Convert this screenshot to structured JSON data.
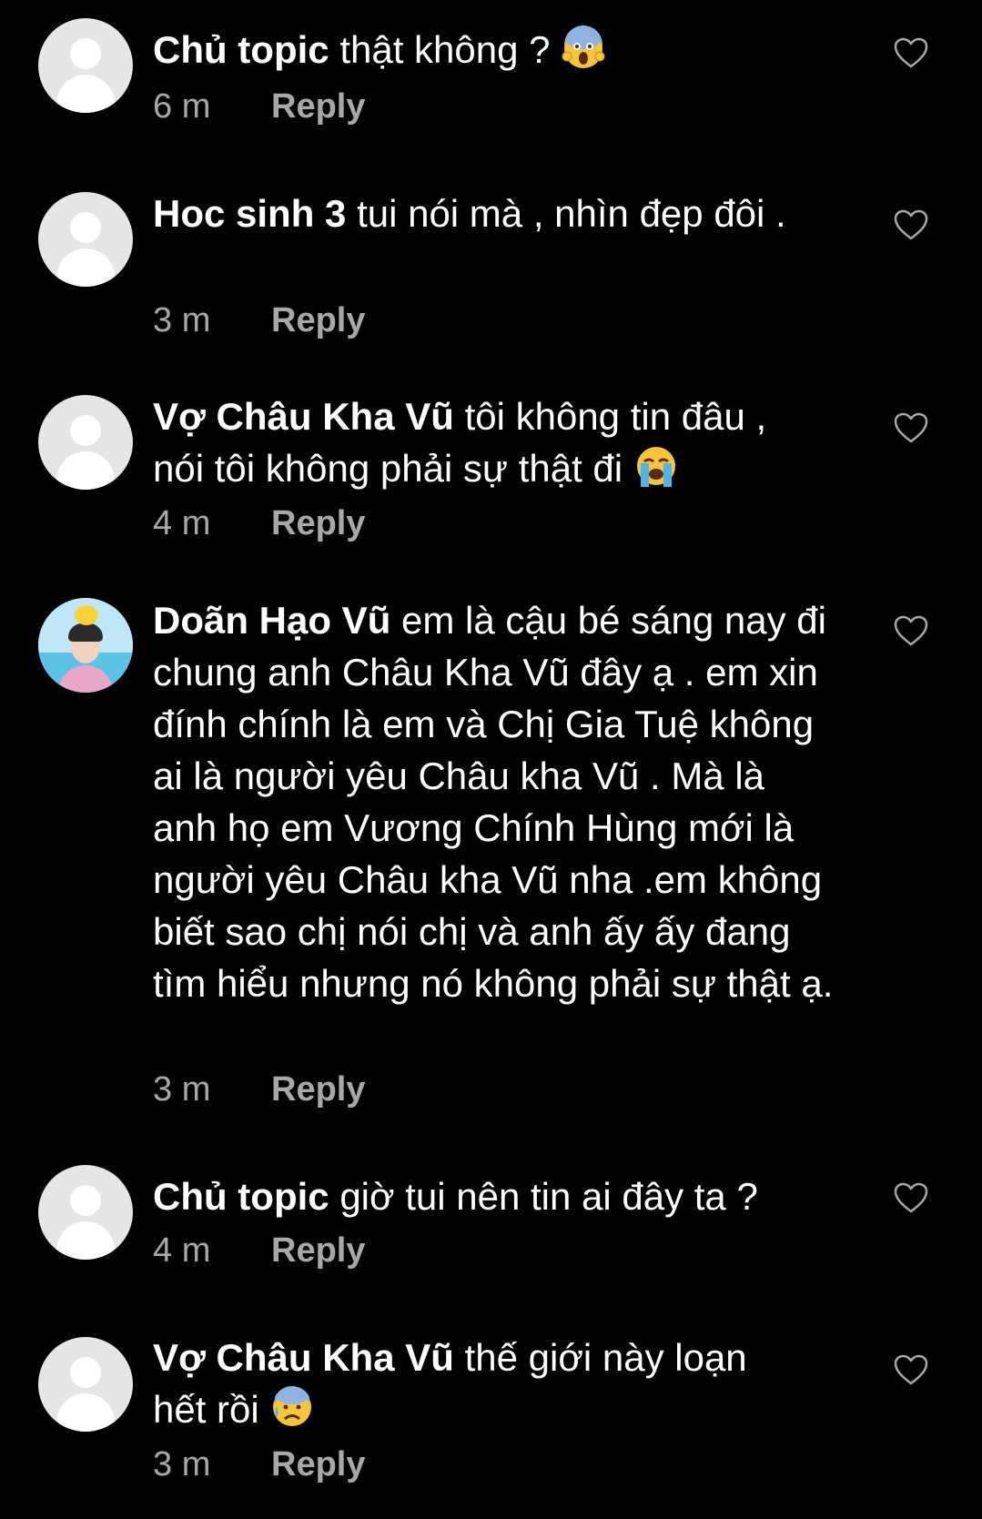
{
  "comments": [
    {
      "author": "Chủ topic",
      "text": "thật không ?",
      "emoji": "face-screaming-in-fear-icon",
      "time": "6 m",
      "reply": "Reply"
    },
    {
      "author": "Hoc sinh 3",
      "text": "tui nói mà , nhìn đẹp đôi .",
      "time": "3 m",
      "reply": "Reply"
    },
    {
      "author": "Vợ Châu Kha Vũ",
      "text": "tôi không tin đâu , nói tôi không phải sự thật đi",
      "emoji": "loudly-crying-face-icon",
      "time": "4 m",
      "reply": "Reply"
    },
    {
      "author": "Doãn Hạo Vũ",
      "text": "em là cậu bé sáng nay đi chung anh Châu Kha Vũ đây ạ . em xin đính chính là em và Chị Gia Tuệ không ai là người yêu Châu kha Vũ . Mà là anh họ em Vương Chính Hùng mới là người yêu Châu kha Vũ nha .em không biết sao chị nói chị và anh ấy ấy đang tìm hiểu nhưng nó không phải sự thật ạ.",
      "time": "3 m",
      "reply": "Reply"
    },
    {
      "author": "Chủ topic",
      "text": "giờ tui nên tin ai đây ta ?",
      "time": "4 m",
      "reply": "Reply"
    },
    {
      "author": "Vợ Châu Kha Vũ",
      "text": "thế giới này loạn hết rồi",
      "emoji": "anxious-face-with-sweat-icon",
      "time": "3 m",
      "reply": "Reply"
    }
  ],
  "icons": {
    "like": "heart-outline-icon",
    "avatar": "default-avatar-icon"
  },
  "colors": {
    "background": "#000000",
    "text": "#ffffff",
    "secondary": "#a8a8a8",
    "avatar_placeholder": "#e6e6e6"
  }
}
